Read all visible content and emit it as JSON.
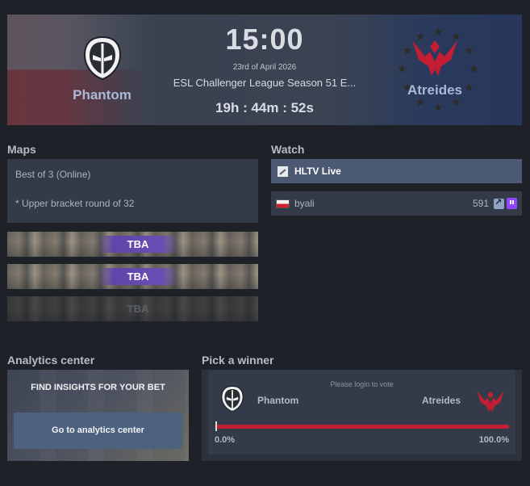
{
  "match": {
    "time": "15:00",
    "date": "23rd of April 2026",
    "event": "ESL Challenger League Season 51 E...",
    "countdown": "19h : 44m : 52s",
    "team1": {
      "name": "Phantom",
      "logo": "phantom-logo"
    },
    "team2": {
      "name": "Atreides",
      "logo": "atreides-logo"
    }
  },
  "maps": {
    "title": "Maps",
    "format": "Best of 3 (Online)",
    "note": "* Upper bracket round of 32",
    "items": [
      {
        "label": "TBA"
      },
      {
        "label": "TBA"
      },
      {
        "label": "TBA"
      }
    ]
  },
  "watch": {
    "title": "Watch",
    "live_label": "HLTV Live",
    "streams": [
      {
        "flag": "Poland",
        "name": "byali",
        "viewers": "591",
        "platform": "twitch-icon"
      }
    ]
  },
  "analytics": {
    "title": "Analytics center",
    "headline": "FIND INSIGHTS FOR YOUR BET",
    "button": "Go to analytics center"
  },
  "pick_winner": {
    "title": "Pick a winner",
    "note": "Please login to vote",
    "team1": "Phantom",
    "team2": "Atreides",
    "team1_pct": "0.0%",
    "team2_pct": "100.0%"
  },
  "colors": {
    "accent_red": "#c41e34",
    "live_bar": "#4b5a72",
    "tba_purple": "#6a4eb5",
    "team_name": "#a9b8d6"
  }
}
